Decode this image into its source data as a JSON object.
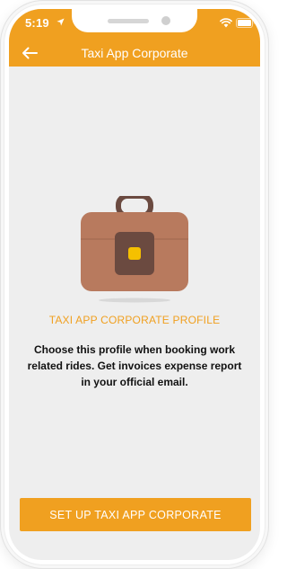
{
  "status_bar": {
    "time": "5:19",
    "location_icon": "location-arrow-icon",
    "wifi_icon": "wifi-icon",
    "battery_icon": "battery-icon"
  },
  "header": {
    "back_icon": "arrow-left-icon",
    "title": "Taxi App Corporate"
  },
  "illustration": {
    "icon": "briefcase-icon"
  },
  "profile": {
    "heading": "TAXI APP CORPORATE PROFILE",
    "description": "Choose this profile when booking work related rides. Get invoices expense report in your official email."
  },
  "actions": {
    "setup_label": "SET UP TAXI APP CORPORATE"
  },
  "colors": {
    "accent": "#f0a020",
    "background": "#eeeeee",
    "text": "#111111",
    "briefcase_body": "#b87a5e",
    "briefcase_dark": "#6b4a40",
    "clasp": "#f5c000"
  }
}
